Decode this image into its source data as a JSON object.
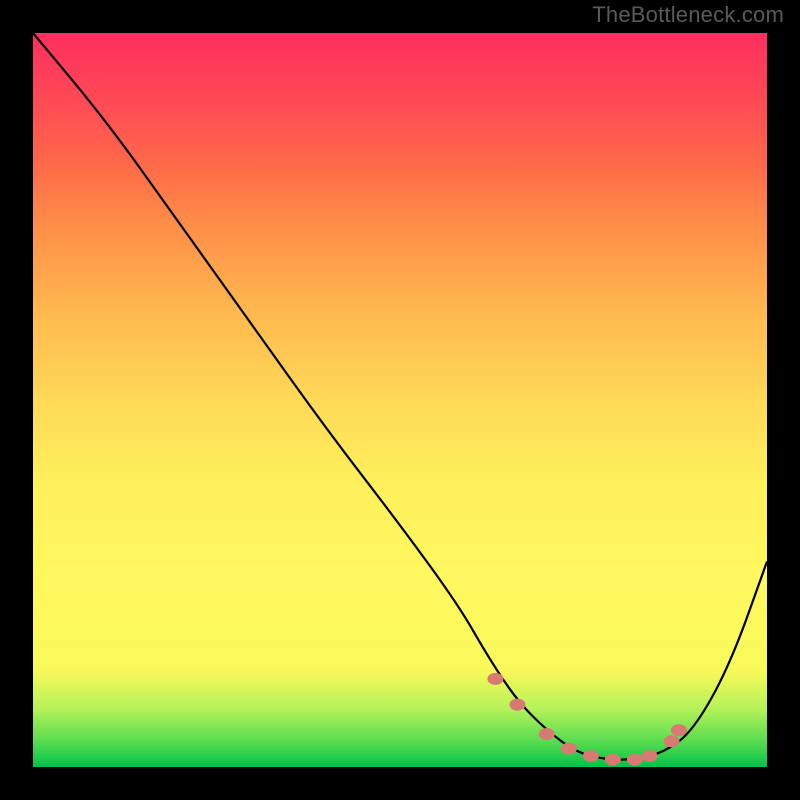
{
  "watermark": "TheBottleneck.com",
  "chart_data": {
    "type": "line",
    "title": "",
    "xlabel": "",
    "ylabel": "",
    "xlim": [
      0,
      100
    ],
    "ylim": [
      0,
      100
    ],
    "grid": false,
    "series": [
      {
        "name": "bottleneck-curve",
        "x": [
          0,
          10,
          20,
          30,
          40,
          50,
          58,
          62,
          66,
          70,
          74,
          78,
          82,
          86,
          90,
          95,
          100
        ],
        "y": [
          100,
          88,
          74,
          60,
          46,
          33,
          22,
          15,
          9,
          5,
          2,
          1,
          1,
          2,
          5,
          14,
          28
        ]
      }
    ],
    "markers": {
      "name": "highlight-markers",
      "x": [
        63,
        66,
        70,
        73,
        76,
        79,
        82,
        84,
        87,
        88
      ],
      "y": [
        12,
        8.5,
        4.5,
        2.5,
        1.5,
        1,
        1,
        1.5,
        3.5,
        5
      ]
    },
    "background_gradient": {
      "type": "vertical",
      "stops": [
        {
          "pos": 0,
          "color": "#00c34a"
        },
        {
          "pos": 13,
          "color": "#f7f95a"
        },
        {
          "pos": 50,
          "color": "#ffd958"
        },
        {
          "pos": 100,
          "color": "#ff2f5f"
        }
      ]
    }
  }
}
